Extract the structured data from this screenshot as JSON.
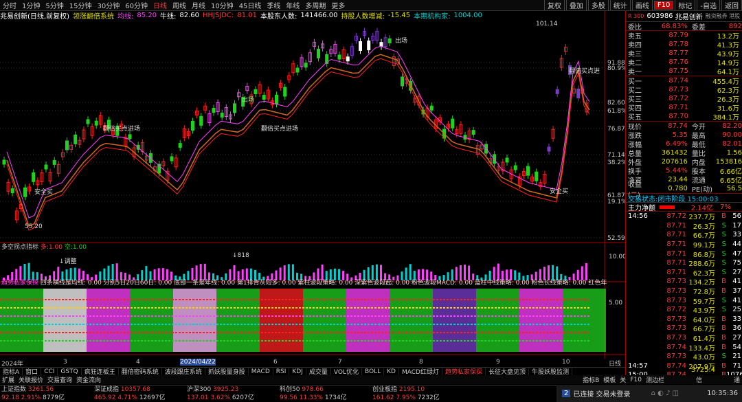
{
  "toolbar": {
    "periods": [
      "分时",
      "1分钟",
      "5分钟",
      "15分钟",
      "30分钟",
      "60分钟",
      "日线",
      "周线",
      "月线",
      "10分钟",
      "45日线",
      "季线",
      "年线",
      "多周期",
      "更多"
    ],
    "active": "日线",
    "right": [
      "复权",
      "叠加",
      "多股",
      "统计",
      "画线",
      "F10",
      "标记",
      "-自选",
      "返回"
    ]
  },
  "title": {
    "stock": "兆易创新(日线,前复权)",
    "system": "领涨翻倍系统",
    "junxian_label": "均线:",
    "junxian_value": "85.20",
    "niuxian_label": "牛线:",
    "niuxian_value": "82.60",
    "hhjs_label": "HHJSJDC:",
    "hhjs_value": "81.01",
    "holders_label": "本股东人数:",
    "holders_value": "141466.00",
    "change_label": "持股人数增减:",
    "change_value": "-15.45",
    "inst_label": "本期机构家:",
    "inst_value": "1004.00"
  },
  "price_axis": [
    "91.88",
    "80.9%",
    "82.60",
    "61.8%",
    "76.87",
    "71.14",
    "38.2%",
    "61.87",
    "19.1%",
    "52.59"
  ],
  "chart_labels": {
    "high": "101.14",
    "low": "55.20",
    "ann1": "翻倍买点进场",
    "ann2": "翻倍买点进场",
    "ann3": "安全买",
    "ann4": "安全买",
    "ann5": "出场",
    "ann6": "翻倍买点进",
    "ann7": "出场"
  },
  "sub1": {
    "title": "多空拐点指标",
    "v1_label": "多:",
    "v1": "1.00",
    "v2_label": "空:",
    "v2": "1.00",
    "axis": "10.00",
    "ann": "↓调整",
    "ann2": "↓818"
  },
  "sub2": {
    "title": "趋势私家保探",
    "desc": "四条横线是均线: 0.00 分别5日20日60日: 0.00 底部一条是年线: 0.00 第1排青灰短多: 0.00 紫柱波段策略: 0.00 深紫色波段起: 0.00 粉色波段MACD: 0.00 蓝柱中线策略: 0.00 粉色长线策略: 0.00 红色年",
    "axis": "5.00"
  },
  "xaxis": [
    "2024年",
    "3",
    "4",
    "2024/04/22",
    "5",
    "6",
    "7",
    "8",
    "9",
    "10",
    "日线"
  ],
  "indicator_tabs": [
    "指标A",
    "窗口",
    "CCI",
    "GSTQ",
    "疯狂连板王",
    "翻倍密码系统",
    "波段跟庄系统",
    "抓妖股量身股",
    "MACD",
    "RSI",
    "KDJ",
    "成交量",
    "VOL优化",
    "BOLL",
    "KD",
    "MACD红绿灯",
    "趋势私家保探",
    "长征大盘见顶",
    "牛股妖股监测"
  ],
  "indicator_active": "趋势私家保探",
  "row2_left": [
    "扩展",
    "关联报价",
    "交易查询",
    "资金流向"
  ],
  "row2_right": [
    "指标B",
    "模板",
    "关",
    "F10",
    "测边栏"
  ],
  "row2_r2": [
    "信",
    "通"
  ],
  "indices": [
    {
      "name": "上证指数",
      "value": "3261.56",
      "chg": "92.18",
      "pct": "2.91%",
      "amt": "8779亿"
    },
    {
      "name": "深证成指",
      "value": "10357.68",
      "chg": "465.92",
      "pct": "4.71%",
      "amt": "12697亿"
    },
    {
      "name": "沪深300",
      "value": "3925.23",
      "chg": "137.01",
      "pct": "3.62%",
      "amt": "6207亿"
    },
    {
      "name": "科创50",
      "value": "978.66",
      "chg": "99.56",
      "pct": "11.33%",
      "amt": "1734亿"
    },
    {
      "name": "创业板指",
      "value": "2195.10",
      "chg": "161.62",
      "pct": "7.95%",
      "amt": "7232亿"
    }
  ],
  "taskbar": {
    "connect": "已连接 交易未登录",
    "time": "10:35:36"
  },
  "panel": {
    "code": "603986",
    "name": "兆易创新",
    "tag": "R 300",
    "extra": "融资融券 港股",
    "weibi_label": "委比",
    "weibi": "68.83%",
    "weicha_label": "委差",
    "weicha": "892",
    "asks": [
      {
        "l": "卖五",
        "p": "87.79",
        "v": "13.2万"
      },
      {
        "l": "卖四",
        "p": "87.78",
        "v": "41.3万"
      },
      {
        "l": "卖三",
        "p": "87.77",
        "v": "43.9万"
      },
      {
        "l": "卖二",
        "p": "87.76",
        "v": "14.9万"
      },
      {
        "l": "卖一",
        "p": "87.75",
        "v": "64.1万"
      }
    ],
    "bids": [
      {
        "l": "买一",
        "p": "87.74",
        "v": "455.4万"
      },
      {
        "l": "买二",
        "p": "87.73",
        "v": "62.3万"
      },
      {
        "l": "买三",
        "p": "87.72",
        "v": "26.3万"
      },
      {
        "l": "买四",
        "p": "87.71",
        "v": "31.6万"
      },
      {
        "l": "买五",
        "p": "87.70",
        "v": "384.1万"
      }
    ],
    "stats": [
      {
        "a": "现价",
        "av": "87.74",
        "b": "今开",
        "bv": "82.20"
      },
      {
        "a": "涨跌",
        "av": "5.35",
        "b": "最高",
        "bv": "90.00"
      },
      {
        "a": "涨幅",
        "av": "6.49%",
        "b": "最低",
        "bv": "82.01"
      },
      {
        "a": "总量",
        "av": "361432",
        "b": "量比",
        "bv": "1.56"
      },
      {
        "a": "外盘",
        "av": "207616",
        "b": "内盘",
        "bv": "153816"
      },
      {
        "a": "换手",
        "av": "5.44%",
        "b": "股本",
        "bv": "6.66亿"
      },
      {
        "a": "净资",
        "av": "23.44",
        "b": "流通",
        "bv": "6.65亿"
      },
      {
        "a": "收益(二)",
        "av": "0.780",
        "b": "PE(动)",
        "bv": "56.5"
      }
    ],
    "status_label": "交易状态:",
    "status": "闭市阶段 15:00:03",
    "flow_label": "主力净额",
    "flow": "2.14亿",
    "flow_pct": "7%",
    "ticks": [
      {
        "t": "14:56",
        "p": "87.72",
        "v": "237.7万",
        "d": "B",
        "n": "56"
      },
      {
        "t": "",
        "p": "87.71",
        "v": "26.3万",
        "d": "S",
        "n": "17"
      },
      {
        "t": "",
        "p": "87.71",
        "v": "66.7万",
        "d": "S",
        "n": "33"
      },
      {
        "t": "",
        "p": "87.71",
        "v": "99.1万",
        "d": "S",
        "n": "44"
      },
      {
        "t": "",
        "p": "87.71",
        "v": "86.8万",
        "d": "S",
        "n": "47"
      },
      {
        "t": "",
        "p": "87.71",
        "v": "288.6万",
        "d": "S",
        "n": "75"
      },
      {
        "t": "",
        "p": "87.71",
        "v": "62.3万",
        "d": "S",
        "n": "27"
      },
      {
        "t": "",
        "p": "87.73",
        "v": "134.2万",
        "d": "B",
        "n": "41"
      },
      {
        "t": "",
        "p": "87.73",
        "v": "72.8万",
        "d": "B",
        "n": "37"
      },
      {
        "t": "",
        "p": "87.73",
        "v": "59.7万",
        "d": "S",
        "n": "41"
      },
      {
        "t": "",
        "p": "87.72",
        "v": "43.9万",
        "d": "S",
        "n": "25"
      },
      {
        "t": "",
        "p": "87.73",
        "v": "64.0万",
        "d": "B",
        "n": "33"
      },
      {
        "t": "",
        "p": "87.73",
        "v": "66.7万",
        "d": "B",
        "n": "36"
      },
      {
        "t": "",
        "p": "87.73",
        "v": "61.4万",
        "d": "B",
        "n": "27"
      },
      {
        "t": "",
        "p": "87.74",
        "v": "133.4万",
        "d": "B",
        "n": "54"
      },
      {
        "t": "",
        "p": "87.73",
        "v": "43.0万",
        "d": "S",
        "n": "21"
      },
      {
        "t": "14:57",
        "p": "87.74",
        "v": "207.9万",
        "d": "B",
        "n": "71"
      },
      {
        "t": "15:00",
        "p": "87.74",
        "v": "3725.4万",
        "d": "B",
        "n": "1076"
      }
    ]
  }
}
